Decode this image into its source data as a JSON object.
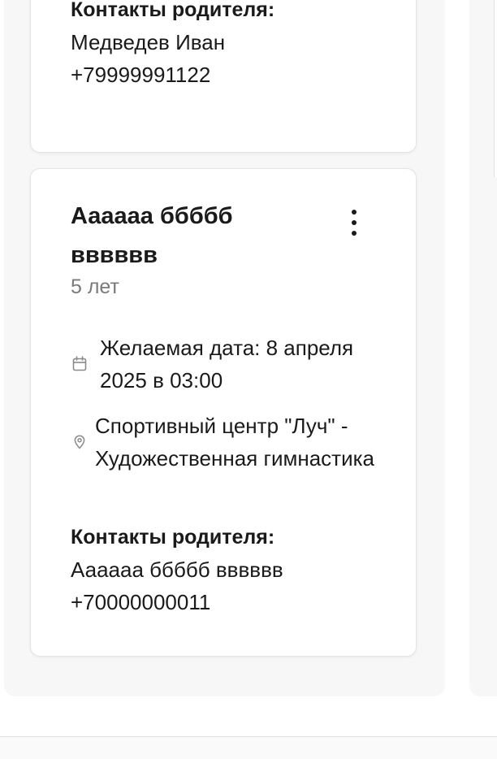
{
  "cards": [
    {
      "contacts_label": "Контакты родителя:",
      "parent_name": "Медведев Иван",
      "parent_phone": "+79999991122"
    },
    {
      "child_name": "Аааааа ббббб вввввв",
      "age": "5 лет",
      "desired_date": "Желаемая дата: 8 апреля 2025 в 03:00",
      "location": "Спортивный центр \"Луч\" - Художественная гимнастика",
      "contacts_label": "Контакты родителя:",
      "parent_name": "Аааааа ббббб вввввв",
      "parent_phone": "+70000000011",
      "menu_icon": "more-vertical-icon",
      "date_icon": "calendar-icon",
      "location_icon": "map-pin-icon"
    }
  ],
  "colors": {
    "column_bg": "#f7f7f7",
    "card_bg": "#ffffff",
    "muted_text": "#7a7a7a"
  }
}
